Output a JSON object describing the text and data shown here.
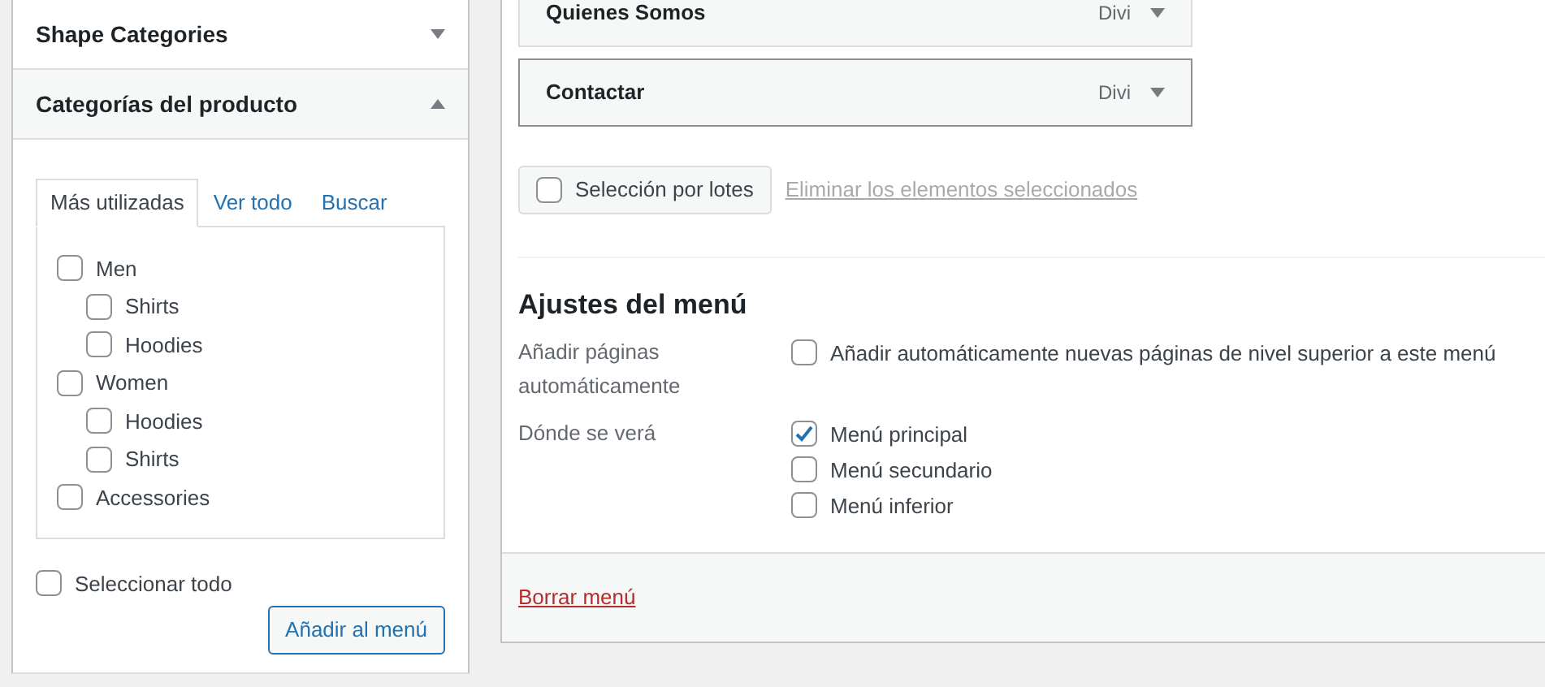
{
  "sidebar": {
    "sections": [
      {
        "title": "Shape Categories",
        "expanded": false
      },
      {
        "title": "Categorías del producto",
        "expanded": true
      }
    ],
    "tabs": [
      {
        "label": "Más utilizadas",
        "selected": true
      },
      {
        "label": "Ver todo",
        "selected": false
      },
      {
        "label": "Buscar",
        "selected": false
      }
    ],
    "categories": [
      {
        "label": "Men",
        "checked": false,
        "children": [
          {
            "label": "Shirts",
            "checked": false
          },
          {
            "label": "Hoodies",
            "checked": false
          }
        ]
      },
      {
        "label": "Women",
        "checked": false,
        "children": [
          {
            "label": "Hoodies",
            "checked": false
          },
          {
            "label": "Shirts",
            "checked": false
          }
        ]
      },
      {
        "label": "Accessories",
        "checked": false
      }
    ],
    "select_all": {
      "label": "Seleccionar todo",
      "checked": false
    },
    "add_button": "Añadir al menú"
  },
  "menu_items": [
    {
      "title": "Quienes Somos",
      "type": "Divi",
      "focused": false
    },
    {
      "title": "Contactar",
      "type": "Divi",
      "focused": true
    }
  ],
  "bulk_select": {
    "label": "Selección por lotes",
    "checked": false
  },
  "delete_selected": "Eliminar los elementos seleccionados",
  "settings": {
    "heading": "Ajustes del menú",
    "auto_add": {
      "label": "Añadir páginas automáticamente",
      "options": [
        {
          "label": "Añadir automáticamente nuevas páginas de nivel superior a este menú",
          "checked": false
        }
      ]
    },
    "locations": {
      "label": "Dónde se verá",
      "options": [
        {
          "label": "Menú principal",
          "checked": true
        },
        {
          "label": "Menú secundario",
          "checked": false
        },
        {
          "label": "Menú inferior",
          "checked": false
        }
      ]
    }
  },
  "delete_menu": "Borrar menú"
}
